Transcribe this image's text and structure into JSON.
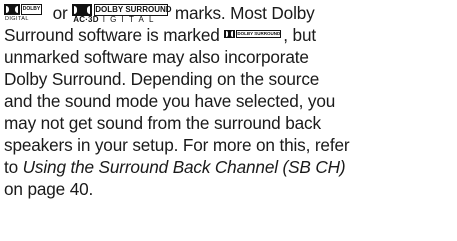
{
  "logos": {
    "dolby_digital": {
      "box_text": "DOLBY",
      "sub_text": "DIGITAL"
    },
    "dolby_surround_ac3": {
      "box_text": "DOLBY SURROUND",
      "sub_prefix": "AC·3D",
      "sub_text": "IGITAL"
    },
    "dolby_surround_small": {
      "box_text": "DOLBY SURROUND"
    }
  },
  "text": {
    "line1_or": " or ",
    "line1_end": " marks. Most Dolby",
    "line2_start": "Surround software is marked ",
    "line2_end": ", but",
    "line3": "unmarked software may also incorporate",
    "line4": "Dolby Surround. Depending on the source",
    "line5": "and the sound mode you have selected, you",
    "line6": "may not get sound from the surround back",
    "line7": "speakers in your setup. For more on this, refer",
    "line8_prefix": "to ",
    "line8_italic": "Using the Surround Back Channel (SB CH)",
    "line9": "on page 40."
  }
}
